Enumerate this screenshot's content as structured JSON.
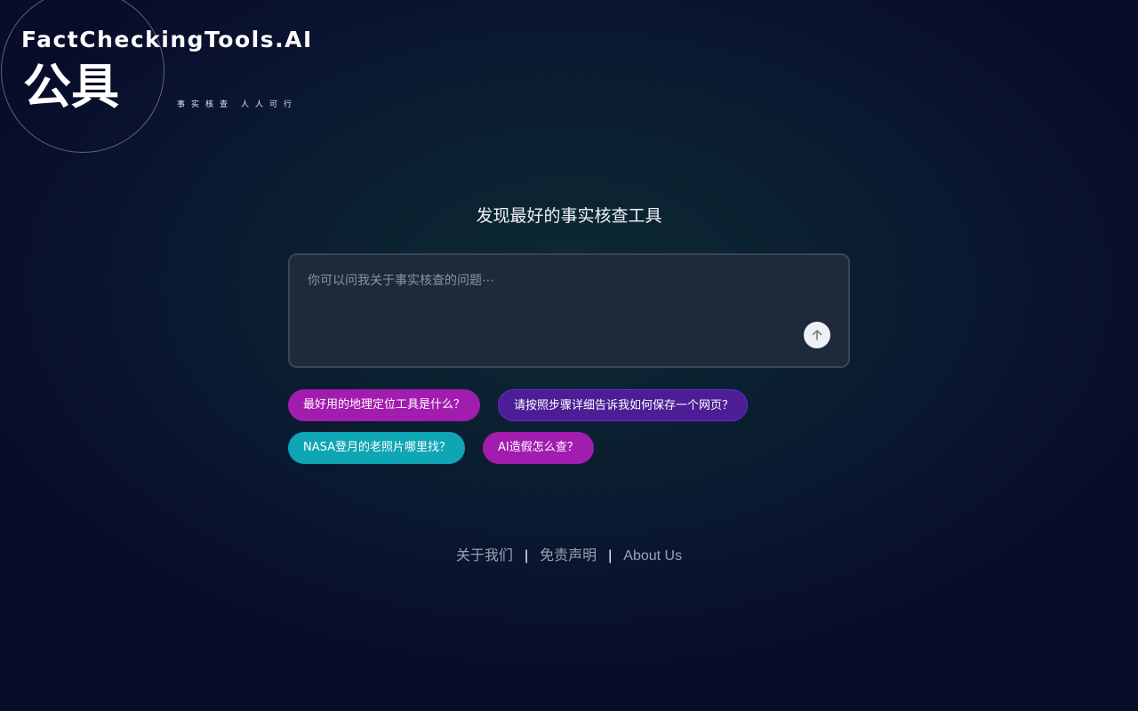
{
  "header": {
    "brand": "FactCheckingTools.AI",
    "logo_chars": "公具",
    "tagline_left": "事实核查",
    "tagline_right": "人人可行"
  },
  "main": {
    "headline": "发现最好的事实核查工具",
    "search": {
      "placeholder": "你可以问我关于事实核查的问题⋯",
      "value": "",
      "send_icon": "arrow-up-icon"
    },
    "suggestions": [
      {
        "label": "最好用的地理定位工具是什么？",
        "color": "#a21caf"
      },
      {
        "label": "请按照步骤详细告诉我如何保存一个网页？",
        "color": "#4c1d95"
      },
      {
        "label": "NASA登月的老照片哪里找？",
        "color": "#0ea5b5"
      },
      {
        "label": "AI造假怎么查？",
        "color": "#a21caf"
      }
    ]
  },
  "footer": {
    "links": [
      "关于我们",
      "免责声明",
      "About Us"
    ],
    "separator": "|"
  }
}
